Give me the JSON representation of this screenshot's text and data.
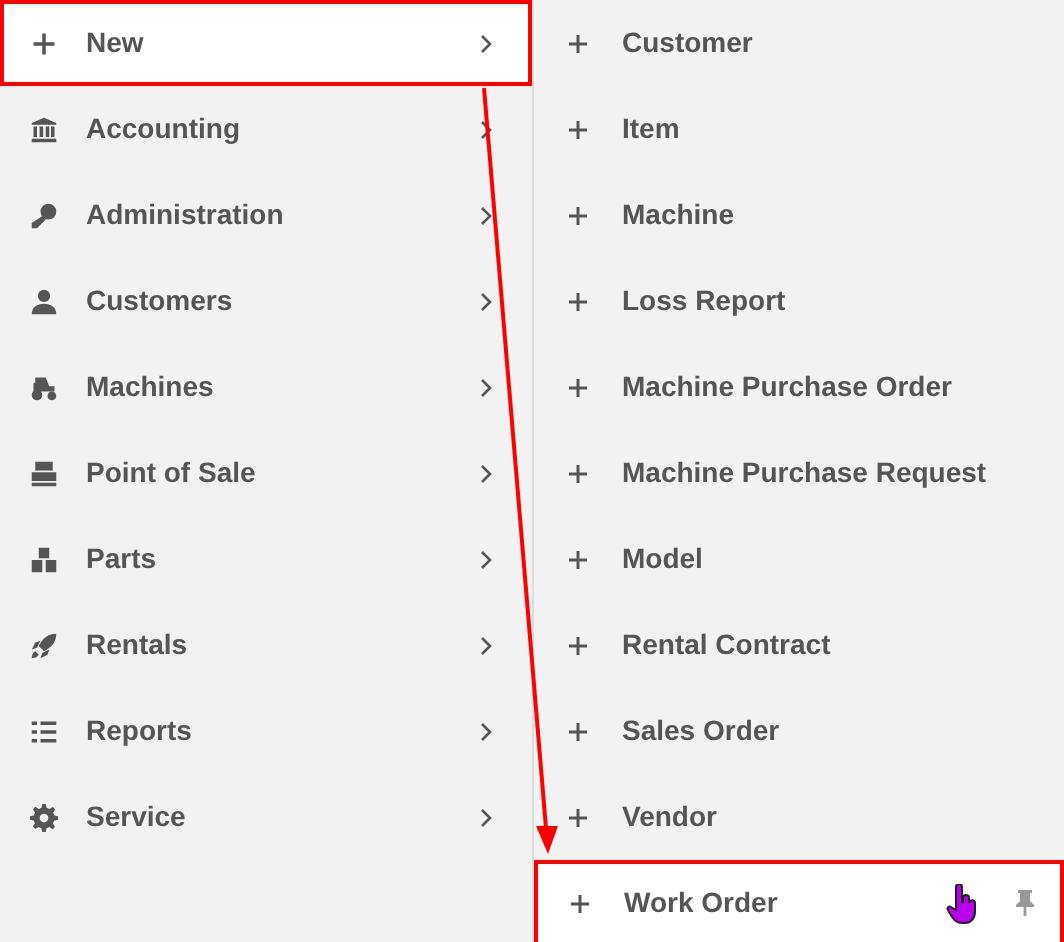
{
  "menu": {
    "items": [
      {
        "label": "New",
        "selected": true
      },
      {
        "label": "Accounting",
        "selected": false
      },
      {
        "label": "Administration",
        "selected": false
      },
      {
        "label": "Customers",
        "selected": false
      },
      {
        "label": "Machines",
        "selected": false
      },
      {
        "label": "Point of Sale",
        "selected": false
      },
      {
        "label": "Parts",
        "selected": false
      },
      {
        "label": "Rentals",
        "selected": false
      },
      {
        "label": "Reports",
        "selected": false
      },
      {
        "label": "Service",
        "selected": false
      }
    ]
  },
  "submenu": {
    "items": [
      {
        "label": "Customer",
        "selected": false
      },
      {
        "label": "Item",
        "selected": false
      },
      {
        "label": "Machine",
        "selected": false
      },
      {
        "label": "Loss Report",
        "selected": false
      },
      {
        "label": "Machine Purchase Order",
        "selected": false
      },
      {
        "label": "Machine Purchase Request",
        "selected": false
      },
      {
        "label": "Model",
        "selected": false
      },
      {
        "label": "Rental Contract",
        "selected": false
      },
      {
        "label": "Sales Order",
        "selected": false
      },
      {
        "label": "Vendor",
        "selected": false
      },
      {
        "label": "Work Order",
        "selected": true
      }
    ]
  }
}
